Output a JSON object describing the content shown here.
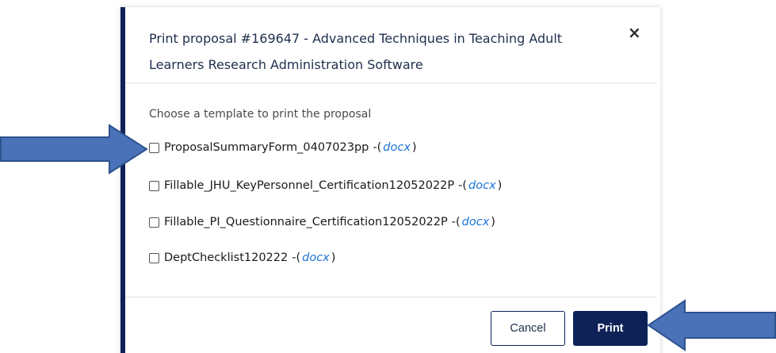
{
  "dialog": {
    "title": "Print proposal #169647 - Advanced Techniques in Teaching Adult Learners Research Administration Software",
    "close_label": "×",
    "instruction": "Choose a template to print the proposal",
    "templates": [
      {
        "name": "ProposalSummaryForm_0407023pp",
        "prefix": "-(",
        "ext": "docx",
        "suffix": ")",
        "checked": false
      },
      {
        "name": "Fillable_JHU_KeyPersonnel_Certification12052022P",
        "prefix": "-(",
        "ext": "docx",
        "suffix": ")",
        "checked": false
      },
      {
        "name": "Fillable_PI_Questionnaire_Certification12052022P",
        "prefix": "-(",
        "ext": "docx",
        "suffix": ")",
        "checked": false
      },
      {
        "name": "DeptChecklist120222",
        "prefix": "-(",
        "ext": "docx",
        "suffix": ")",
        "checked": false
      }
    ],
    "cancel_label": "Cancel",
    "print_label": "Print"
  },
  "annotations": {
    "arrow_color": "#4a72b8",
    "arrow_outline": "#2f528f"
  },
  "colors": {
    "accent": "#0e2258",
    "link": "#1a73d9"
  }
}
